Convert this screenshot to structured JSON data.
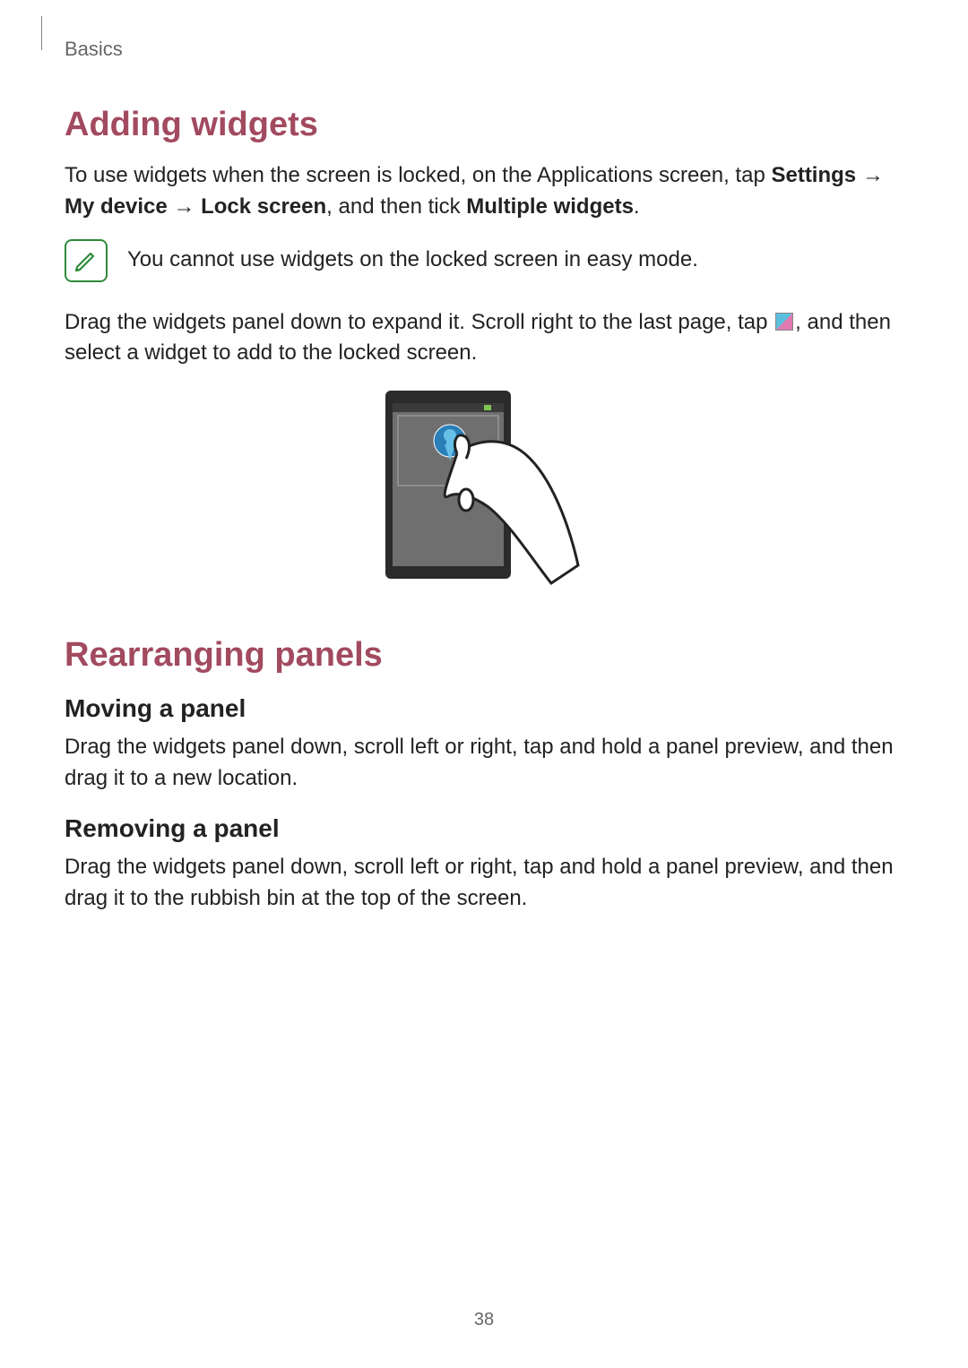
{
  "breadcrumb": "Basics",
  "section1": {
    "title": "Adding widgets",
    "intro_pre": "To use widgets when the screen is locked, on the Applications screen, tap ",
    "path_settings": "Settings",
    "arrow": " → ",
    "path_mydevice": "My device",
    "path_lockscreen": "Lock screen",
    "intro_mid": ", and then tick ",
    "path_multiwidgets": "Multiple widgets",
    "intro_end": ".",
    "note": "You cannot use widgets on the locked screen in easy mode.",
    "drag_pre": "Drag the widgets panel down to expand it. Scroll right to the last page, tap ",
    "drag_post": ", and then select a widget to add to the locked screen."
  },
  "section2": {
    "title": "Rearranging panels",
    "moving_title": "Moving a panel",
    "moving_body": "Drag the widgets panel down, scroll left or right, tap and hold a panel preview, and then drag it to a new location.",
    "removing_title": "Removing a panel",
    "removing_body": "Drag the widgets panel down, scroll left or right, tap and hold a panel preview, and then drag it to the rubbish bin at the top of the screen."
  },
  "page_number": "38"
}
